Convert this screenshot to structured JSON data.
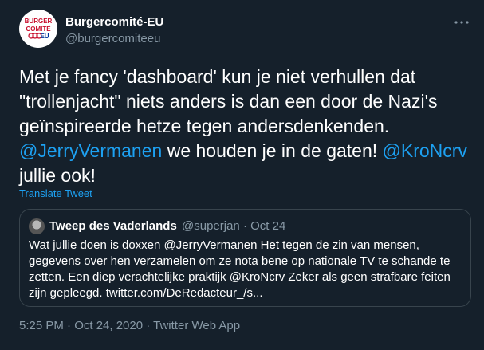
{
  "tweet": {
    "author_name": "Burgercomité-EU",
    "author_handle": "@burgercomiteeu",
    "avatar_lines": [
      "BURGER",
      "COMITÉ",
      "EU"
    ],
    "body_line1": "Met je fancy 'dashboard' kun je niet verhullen dat",
    "body_line2": "\"trollenjacht\" niets anders is dan een door de Nazi's",
    "body_line3": "geïnspireerde hetze tegen andersdenkenden.",
    "mention1": "@JerryVermanen",
    "body_after_mention1": " we houden je in de gaten! ",
    "mention2": "@KroNcrv",
    "body_line5": "jullie ook!",
    "translate_label": "Translate Tweet",
    "more_icon": "more-horizontal-icon",
    "timestamp": "5:25 PM · Oct 24, 2020 · Twitter Web App"
  },
  "quote": {
    "author_name": "Tweep des Vaderlands",
    "author_handle": "@superjan",
    "date": "· Oct 24",
    "text_line1": "Wat jullie doen is doxxen @JerryVermanen Het tegen de zin van mensen,",
    "text_line2": "gegevens over hen verzamelen om ze nota bene op nationale TV te schande te",
    "text_line3": "zetten. Een diep verachtelijke praktijk @KroNcrv Zeker als geen strafbare feiten",
    "text_line4": "zijn gepleegd. twitter.com/DeRedacteur_/s..."
  },
  "colors": {
    "background": "#15202b",
    "accent": "#1da1f2",
    "secondary_text": "#8899a6",
    "border": "#38444d"
  }
}
